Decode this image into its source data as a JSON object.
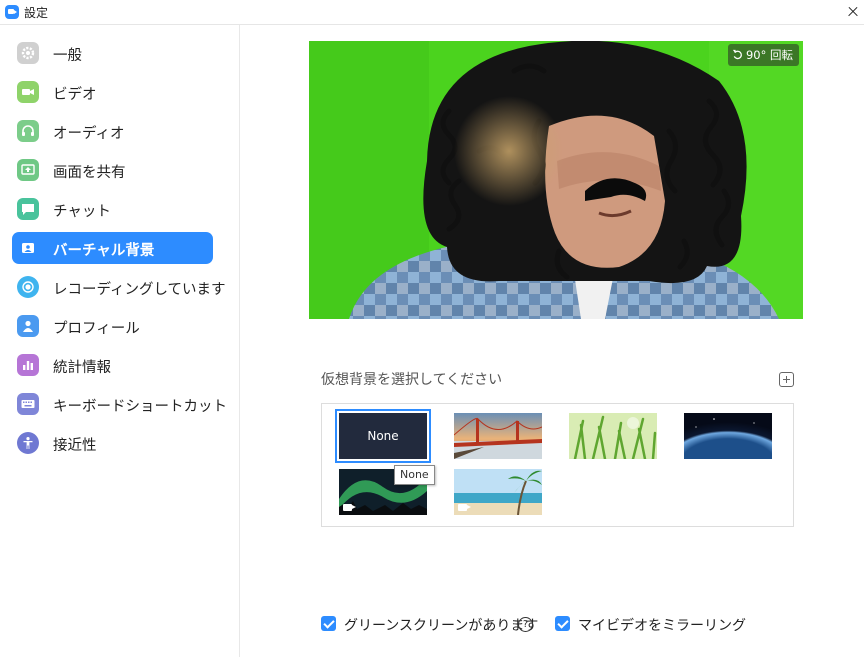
{
  "window": {
    "title": "設定"
  },
  "sidebar": {
    "items": [
      {
        "label": "一般",
        "icon": "gear-icon",
        "color": "#bdbdbd"
      },
      {
        "label": "ビデオ",
        "icon": "video-icon",
        "color": "#8fd36a"
      },
      {
        "label": "オーディオ",
        "icon": "headphones-icon",
        "color": "#7ccd8a"
      },
      {
        "label": "画面を共有",
        "icon": "share-screen-icon",
        "color": "#6fc885"
      },
      {
        "label": "チャット",
        "icon": "chat-icon",
        "color": "#49c39c"
      },
      {
        "label": "バーチャル背景",
        "icon": "virtual-background-icon",
        "color": "#2d8cff",
        "active": true
      },
      {
        "label": "レコーディングしています",
        "icon": "record-icon",
        "color": "#3fb4ef"
      },
      {
        "label": "プロフィール",
        "icon": "profile-icon",
        "color": "#4b9af0"
      },
      {
        "label": "統計情報",
        "icon": "statistics-icon",
        "color": "#b675d6"
      },
      {
        "label": "キーボードショートカット",
        "icon": "keyboard-icon",
        "color": "#7f86d8"
      },
      {
        "label": "接近性",
        "icon": "accessibility-icon",
        "color": "#6f78d2"
      }
    ]
  },
  "preview": {
    "rotate_label": "90° 回転"
  },
  "virtual_background": {
    "section_label": "仮想背景を選択してください",
    "none_label": "None",
    "tooltip": "None",
    "thumbnails": [
      {
        "name": "none"
      },
      {
        "name": "golden-gate-bridge"
      },
      {
        "name": "grass"
      },
      {
        "name": "earth-from-space"
      },
      {
        "name": "aurora",
        "video": true
      },
      {
        "name": "beach-palm",
        "video": true
      }
    ]
  },
  "options": {
    "green_screen_label": "グリーンスクリーンがあります",
    "green_screen_checked": true,
    "mirror_label": "マイビデオをミラーリング",
    "mirror_checked": true
  },
  "colors": {
    "accent": "#2d8cff",
    "green_screen": "#4bd31e"
  }
}
